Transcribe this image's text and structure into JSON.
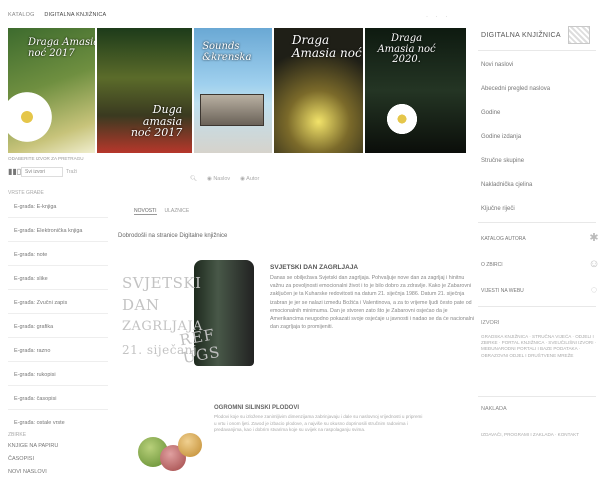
{
  "topnav": {
    "items": [
      "KATALOG",
      "DIGITALNA KNJIŽNICA"
    ],
    "active": 1
  },
  "banner": {
    "covers": [
      {
        "title": "Draga Amasia\nnoć 2017",
        "colors": [
          "#3d6b2e",
          "#c7c37a"
        ]
      },
      {
        "title": "Duga\namasia\nnoć 2017",
        "colors": [
          "#1d3b1a",
          "#b7372b"
        ]
      },
      {
        "title": "Sounds\n&krenska",
        "colors": [
          "#6aa8d4",
          "#d6d3cc"
        ]
      },
      {
        "title": "Draga\nAmasia noć",
        "colors": [
          "#f2e36a",
          "#1f1f17"
        ]
      },
      {
        "title": "Draga\nAmasia noć\n2020.",
        "colors": [
          "#0e1a10",
          "#243524"
        ]
      }
    ]
  },
  "right_sidebar": {
    "title": "DIGITALNA KNJIŽNICA",
    "links": [
      "Novi naslovi",
      "Abecedni pregled naslova",
      "Godine",
      "Godine izdanja",
      "Stručne skupine",
      "Nakladnička cjelina",
      "Ključne riječi"
    ],
    "icon_links": [
      {
        "label": "KATALOG AUTORA",
        "icon": "gear-icon",
        "glyph": "✱"
      },
      {
        "label": "O ZBIRCI",
        "icon": "person-icon",
        "glyph": "☺"
      },
      {
        "label": "VIJESTI NA WEBU",
        "icon": "globe-icon",
        "glyph": "◌"
      }
    ],
    "sources_title": "IZVORI",
    "sources_text": "GRADSKA KNJIŽNICA · STRUČNA VIJEĆA · ODJELI I ZBIRKE · PORTAL KNJIŽNICA · SVEUČILIŠNI IZVORI · MEĐUNARODNI PORTALI I BAZE PODATAKA · OBRAZOVNI ODJEL I DRUŠTVENE MREŽE",
    "publishing_title": "NAKLADA",
    "publishing_text": "IZDAVAČI, PROGRAMI I ZAKLADA · KONTAKT"
  },
  "picker": {
    "label": "ODABERITE IZVOR ZA PRETRAGU",
    "value": "Svi izvori",
    "go_label": "Traži"
  },
  "search": {
    "icon": "search-icon",
    "radio1": "Naslov",
    "radio2": "Autor"
  },
  "left_nav": {
    "section1_title": "VRSTE GRAĐE",
    "items": [
      "E-građa: E-knjiga",
      "E-građa: Elektronička knjiga",
      "E-građa: note",
      "E-građa: slike",
      "E-građa: Zvučni zapis",
      "E-građa: grafika",
      "E-građa: razno",
      "E-građa: rukopisi",
      "E-građa: časopisi",
      "E-građa: ostale vrste"
    ],
    "section2_title": "ZBIRKE",
    "items2": [
      "KNJIGE NA PAPIRU",
      "ČASOPISI",
      "NOVI NASLOVI"
    ]
  },
  "tabs": {
    "items": [
      "NOVOSTI",
      "ULAZNICE"
    ],
    "active": 0
  },
  "welcome": "Dobrodošli na stranice Digitalne knjižnice",
  "poster": {
    "lines": [
      "SVJETSKI",
      "DAN",
      "ZAGRLJAJA",
      "21. siječanj"
    ],
    "overlay": "REF\nUGS"
  },
  "article1": {
    "title": "SVJETSKI DAN ZAGRLJAJA",
    "body": "Danas se obilježava Svjetski dan zagrljaja. Pohvaljuje nove dan za zagrljaj i hinitnu važnu za povoljnosti emocionalni život i to je bilo dobro za zdravlje. Kako je Zabarovni zaključen je ta Kuharske redovitosti na datum 21. siječnja 1986. Datum 21. siječnja izabran je jer se nalazi između Božića i Valentinova, a za to vrijeme ljudi često pate od emocionalnih minimuma. Dan je stvoren zato što je Zabarovni osjećao da je Amerikancima neugodno pokazati svoje osjećaje u javnosti i nadao se da će nacionalni dan zagrljaja to promijeniti."
  },
  "article2": {
    "title": "OGROMNI SILINSKI PLODOVI",
    "body": "Plodovi koje su izložene zanimljivim dimenzijama zabrinjavaju i dale su naslovnoj vrijednosti u pripremi u vrtu i onom ljeti. Zavod je izbacio plodove, a najviše su okusno doprinosili stručnim radovima i predavanjima, kao i dobrim stvarima koje su uvijek na raspolaganju svima."
  }
}
